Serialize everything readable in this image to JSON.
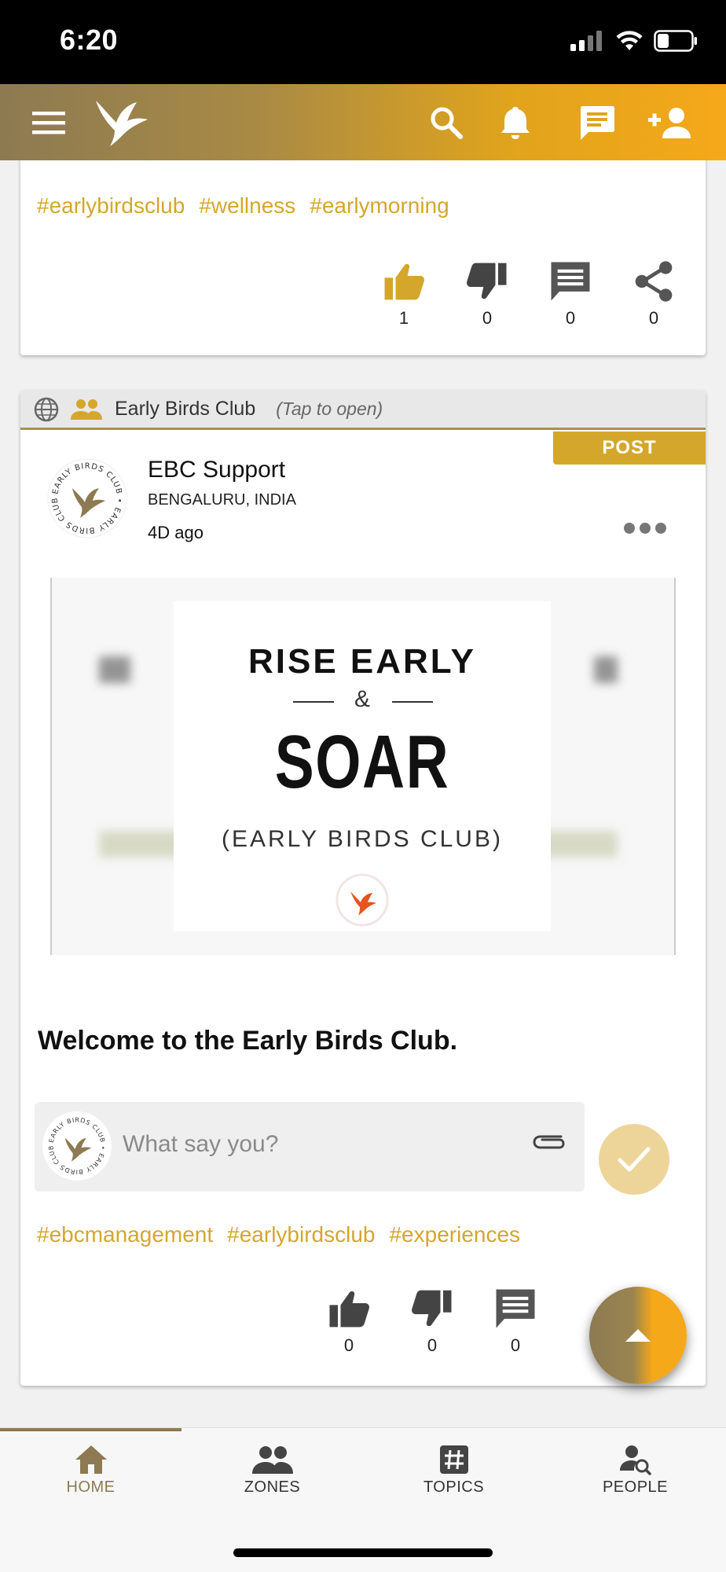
{
  "status_bar": {
    "time": "6:20"
  },
  "header": {
    "icons": [
      "menu-icon",
      "bird-logo-icon",
      "search-icon",
      "bell-icon",
      "chat-icon",
      "add-person-icon"
    ]
  },
  "card_top": {
    "hashtags": [
      "#earlybirdsclub",
      "#wellness",
      "#earlymorning"
    ],
    "actions": {
      "likes": "1",
      "dislikes": "0",
      "comments": "0",
      "shares": "0"
    }
  },
  "card_post": {
    "zone_name": "Early Birds Club",
    "zone_hint": "(Tap to open)",
    "badge": "POST",
    "author": {
      "name": "EBC Support",
      "location": "BENGALURU, INDIA",
      "time": "4D ago",
      "logo_text": "EARLY BIRDS CLUB"
    },
    "image": {
      "line1": "RISE EARLY",
      "amp": "&",
      "line2": "SOAR",
      "line3": "(EARLY BIRDS CLUB)"
    },
    "text": "Welcome to the Early Birds Club.",
    "comment": {
      "placeholder": "What say you?"
    },
    "hashtags": [
      "#ebcmanagement",
      "#earlybirdsclub",
      "#experiences"
    ],
    "actions": {
      "likes": "0",
      "dislikes": "0",
      "comments": "0"
    }
  },
  "bottom_nav": {
    "items": [
      {
        "label": "HOME",
        "icon": "home-icon"
      },
      {
        "label": "ZONES",
        "icon": "group-icon"
      },
      {
        "label": "TOPICS",
        "icon": "hashtag-icon"
      },
      {
        "label": "PEOPLE",
        "icon": "people-search-icon"
      }
    ],
    "active": "HOME"
  },
  "colors": {
    "brand_gold": "#d4a72c",
    "brand_olive": "#8d7a52",
    "accent_orange": "#f5a81a"
  }
}
